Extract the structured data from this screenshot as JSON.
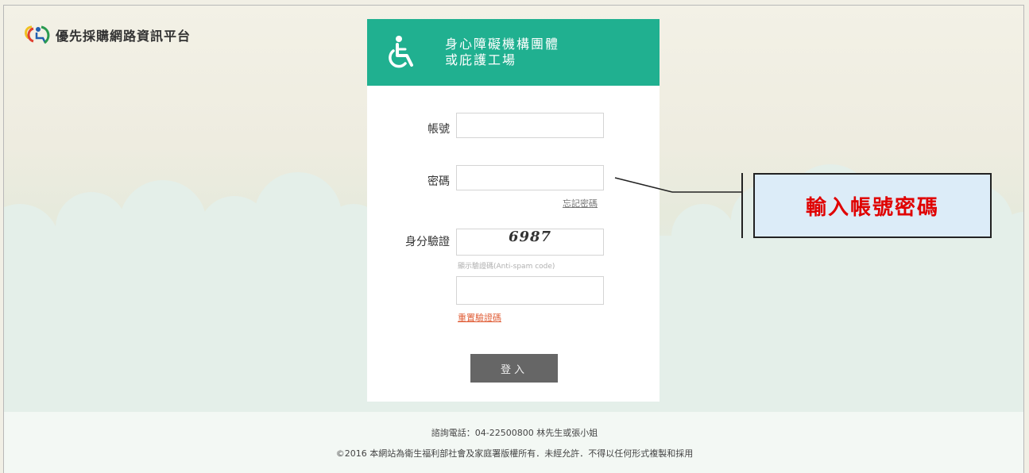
{
  "brand": {
    "logo_icon": "wheelchair-logo-icon",
    "name": "優先採購網路資訊平台"
  },
  "login_panel": {
    "header_icon": "wheelchair-icon",
    "title_line1": "身心障礙機構團體",
    "title_line2": "或庇護工場",
    "account_label": "帳號",
    "account_value": "",
    "password_label": "密碼",
    "password_value": "",
    "forgot_password": "忘記密碼",
    "verify_label": "身分驗證",
    "captcha_code": "6987",
    "captcha_hint": "顯示驗證碼(Anti-spam code)",
    "captcha_input_value": "",
    "reset_captcha": "重置驗證碼",
    "login_button": "登入"
  },
  "callout": {
    "text": "輸入帳號密碼"
  },
  "footer": {
    "contact": "諮詢電話：04-22500800 林先生或張小姐",
    "copyright": "©2016 本網站為衛生福利部社會及家庭署版權所有．未經允許．不得以任何形式複製和採用"
  },
  "colors": {
    "header_green": "#20b090",
    "button_gray": "#666666",
    "reset_link": "#e0603a",
    "callout_text": "#e00000",
    "callout_bg": "#dcecf8"
  }
}
